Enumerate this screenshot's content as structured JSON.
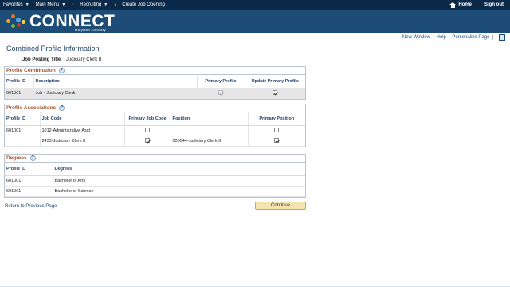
{
  "topnav": {
    "favorites": "Favorites",
    "main_menu": "Main Menu",
    "recruiting": "Recruiting",
    "current": "Create Job Opening",
    "home": "Home",
    "sign_out": "Sign out"
  },
  "banner": {
    "title": "CONNECT",
    "subtitle": "Maryland Judiciary"
  },
  "pagelinks": {
    "new_window": "New Window",
    "help": "Help",
    "personalize": "Personalize Page"
  },
  "page": {
    "title": "Combined Profile Information",
    "posting_label": "Job Posting Title",
    "posting_value": "Judiciary Clerk II"
  },
  "profile_combination": {
    "heading": "Profile Combination",
    "columns": [
      "Profile ID",
      "Description",
      "Primary Profile",
      "Update Primary Profile"
    ],
    "rows": [
      {
        "profile_id": "601001",
        "description": "Job - Judiciary Clerk",
        "primary_profile": true,
        "update_primary": true
      }
    ]
  },
  "profile_associations": {
    "heading": "Profile Associations",
    "columns": [
      "Profile ID",
      "Job Code",
      "Primary Job Code",
      "Position",
      "Primary Position"
    ],
    "rows": [
      {
        "profile_id": "601001",
        "job_code": "1012-Administrative Asst I",
        "primary_job_code": false,
        "position": "",
        "primary_position": false
      },
      {
        "profile_id": "",
        "job_code": "2433-Judiciary Clerk II",
        "primary_job_code": true,
        "position": "000544-Judiciary Clerk II",
        "primary_position": true
      }
    ]
  },
  "degrees": {
    "heading": "Degrees",
    "columns": [
      "Profile ID",
      "Degrees"
    ],
    "rows": [
      {
        "profile_id": "601001",
        "degree": "Bachelor of Arts"
      },
      {
        "profile_id": "601001",
        "degree": "Bachelor of Science"
      }
    ]
  },
  "actions": {
    "return_link": "Return to Previous Page",
    "continue": "Continue"
  },
  "colors": {
    "nav_bg": "#0b2a4a",
    "banner_bg": "#1d4d77",
    "section_heading": "#a0522d",
    "link": "#1a4a7a",
    "button_bg": "#f6e3b2"
  }
}
